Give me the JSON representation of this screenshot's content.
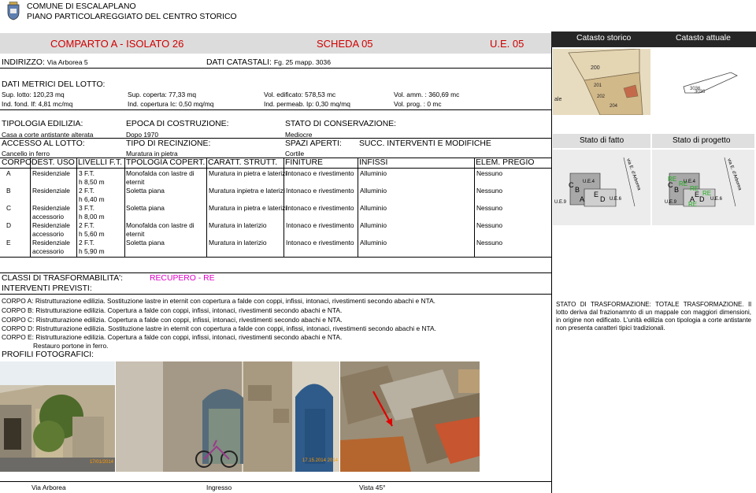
{
  "header": {
    "comune": "COMUNE DI ESCALAPLANO",
    "piano": "PIANO PARTICOLAREGGIATO DEL CENTRO STORICO"
  },
  "titlebar": {
    "comparto": "COMPARTO A - ISOLATO 26",
    "scheda": "SCHEDA 05",
    "ue": "U.E. 05"
  },
  "address": {
    "indirizzo_label": "INDIRIZZO:",
    "indirizzo_value": "Via Arborea 5",
    "catastali_label": "DATI CATASTALI:",
    "catastali_value": "Fg. 25 mapp. 3036"
  },
  "metrics": {
    "title": "DATI METRICI DEL LOTTO:",
    "row1": [
      "Sup. lotto: 120,23 mq",
      "Sup. coperta: 77,33 mq",
      "Vol. edificato: 578,53 mc",
      "Vol. amm. : 360,69 mc"
    ],
    "row2": [
      "Ind. fond. If: 4,81 mc/mq",
      "Ind. copertura Ic: 0,50 mq/mq",
      "Ind. permeab. Ip: 0,30 mq/mq",
      "Vol. prog. : 0 mc"
    ]
  },
  "info": {
    "tipologia_label": "TIPOLOGIA EDILIZIA:",
    "tipologia_value": "Casa a corte antistante alterata",
    "epoca_label": "EPOCA DI COSTRUZIONE:",
    "epoca_value": "Dopo 1970",
    "stato_label": "STATO DI CONSERVAZIONE:",
    "stato_value": "Mediocre",
    "accesso_label": "ACCESSO AL LOTTO:",
    "accesso_value": "Cancello in ferro",
    "recinzione_label": "TIPO DI RECINZIONE:",
    "recinzione_value": "Muratura in pietra",
    "spazi_label": "SPAZI APERTI:",
    "spazi_value": "Cortile",
    "succ_label": "SUCC. INTERVENTI E MODIFICHE"
  },
  "table": {
    "headers": [
      "CORPO",
      "DEST. USO",
      "LIVELLI F.T.",
      "TPOLOGIA COPERT.",
      "CARATT. STRUTT.",
      "FINITURE",
      "INFISSI",
      "ELEM. PREGIO"
    ],
    "rows": [
      {
        "corpo": "A",
        "uso": [
          "Residenziale"
        ],
        "livelli": [
          "3 F.T.",
          "h 8,50 m"
        ],
        "copert": [
          "Monofalda con lastre di",
          "eternit"
        ],
        "strutt": "Muratura in pietra e laterizi",
        "finiture": "Intonaco e rivestimento",
        "infissi": "Alluminio",
        "pregio": "Nessuno"
      },
      {
        "corpo": "B",
        "uso": [
          "Residenziale"
        ],
        "livelli": [
          "2 F.T.",
          "h 6,40 m"
        ],
        "copert": [
          "Soletta piana"
        ],
        "strutt": "Muratura inpietra e laterizi",
        "finiture": "Intonaco e rivestimento",
        "infissi": "Alluminio",
        "pregio": "Nessuno"
      },
      {
        "corpo": "C",
        "uso": [
          "Residenziale",
          "accessorio"
        ],
        "livelli": [
          "3 F.T.",
          "h 8,00 m"
        ],
        "copert": [
          "Soletta piana"
        ],
        "strutt": "Muratura in pietra e laterizi",
        "finiture": "Intonaco e rivestimento",
        "infissi": "Alluminio",
        "pregio": "Nessuno"
      },
      {
        "corpo": "D",
        "uso": [
          "Residenziale",
          "accessorio"
        ],
        "livelli": [
          "2 F.T.",
          "h 5,60 m"
        ],
        "copert": [
          "Monofalda con lastre di",
          "eternit"
        ],
        "strutt": "Muratura in laterizio",
        "finiture": "Intonaco e rivestimento",
        "infissi": "Alluminio",
        "pregio": "Nessuno"
      },
      {
        "corpo": "E",
        "uso": [
          "Residenziale",
          "accessorio"
        ],
        "livelli": [
          "2 F.T.",
          "h 5,90 m"
        ],
        "copert": [
          "Soletta piana"
        ],
        "strutt": "Muratura in laterizio",
        "finiture": "Intonaco e rivestimento",
        "infissi": "Alluminio",
        "pregio": "Nessuno"
      }
    ]
  },
  "classi": {
    "label": "CLASSI DI TRASFORMABILITA':",
    "value": "RECUPERO  - RE"
  },
  "interventi": {
    "label": "INTERVENTI PREVISTI:",
    "lines": [
      "CORPO A: Ristrutturazione edilizia. Sostituzione lastre in eternit con copertura a falde con coppi, infissi, intonaci, rivestimenti secondo abachi e NTA.",
      "CORPO B: Ristrutturazione edilizia. Copertura a falde con coppi, infissi, intonaci, rivestimenti secondo abachi e NTA.",
      "CORPO C: Ristrutturazione edilizia. Copertura a falde con coppi, infissi, intonaci, rivestimenti secondo abachi e NTA.",
      "CORPO D: Ristrutturazione edilizia. Sostituzione lastre in eternit con copertura a falde con coppi, infissi, intonaci, rivestimenti secondo abachi e NTA.",
      "CORPO E: Ristrutturazione edilizia. Copertura a falde con coppi, infissi, intonaci, rivestimenti secondo abachi e NTA."
    ],
    "extra": "Restauro portone in ferro."
  },
  "profili": {
    "label": "PROFILI FOTOGRAFICI:",
    "captions": [
      "Via Arborea",
      "Ingresso",
      "Vista 45°"
    ],
    "date_stamps": [
      "17/01/2014",
      "17.15.2014 2014"
    ]
  },
  "right": {
    "catasto_storico": "Catasto storico",
    "catasto_attuale": "Catasto attuale",
    "map_numbers": [
      "200",
      "201",
      "202",
      "204"
    ],
    "map_fragment": "ale",
    "attuale_labels": [
      "3036",
      "3036"
    ],
    "stato_fatto": "Stato di fatto",
    "stato_progetto": "Stato di progetto",
    "fatto_labels": {
      "street": "via E. d'Arborea",
      "ue4": "U.E.4",
      "ue6": "U.E.6",
      "ue9": "U.E.9",
      "letters": [
        "C",
        "B",
        "E",
        "A",
        "D"
      ]
    },
    "progetto_labels": {
      "street": "via E. d'Arborea",
      "ue4": "U.E.4",
      "ue6": "U.E.6",
      "ue9": "U.E.9",
      "re": "RE",
      "letters": [
        "C",
        "B",
        "E",
        "A",
        "D"
      ]
    },
    "stato_trasf": "STATO DI TRASFORMAZIONE:  TOTALE TRASFORMAZIONE. Il lotto deriva dal frazionamnto di un mappale con maggiori dimensioni, in origine non edificato. L'unità edilizia con tipologia a corte antistante non presenta caratteri tipici tradizionali."
  },
  "colors": {
    "title_red": "#d00000",
    "classe_magenta": "#e000c8",
    "re_green": "#22aa22",
    "panel_dark": "#262626",
    "panel_gray": "#dfdfdf"
  }
}
